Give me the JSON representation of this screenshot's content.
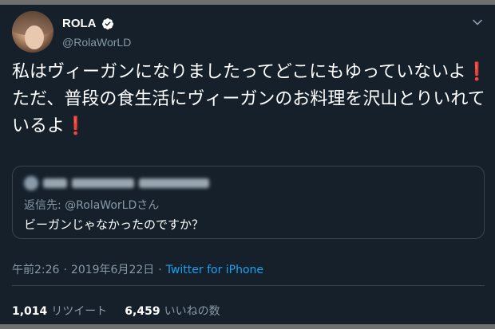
{
  "tweet": {
    "display_name": "ROLA",
    "handle": "@RolaWorLD",
    "text_part1": "私はヴィーガンになりましたってどこにもゆっていないよ",
    "text_part2": " ただ、普段の食生活にヴィーガンのお料理を沢山とりいれているよ",
    "exclamation": "❗"
  },
  "quote": {
    "reply_to": "返信先: @RolaWorLDさん",
    "text": "ビーガンじゃなかったのですか？"
  },
  "meta": {
    "time": "午前2:26",
    "separator1": "·",
    "date": "2019年6月22日",
    "separator2": "·",
    "source": "Twitter for iPhone"
  },
  "stats": {
    "retweets_count": "1,014",
    "retweets_label": "リツイート",
    "likes_count": "6,459",
    "likes_label": "いいねの数"
  },
  "colors": {
    "background": "#15202b",
    "secondary_text": "#8899a6",
    "link": "#1da1f2",
    "exclamation": "#e0245e",
    "border": "#38444d"
  },
  "icons": {
    "verified": "verified-badge-icon",
    "menu": "chevron-down-icon"
  }
}
